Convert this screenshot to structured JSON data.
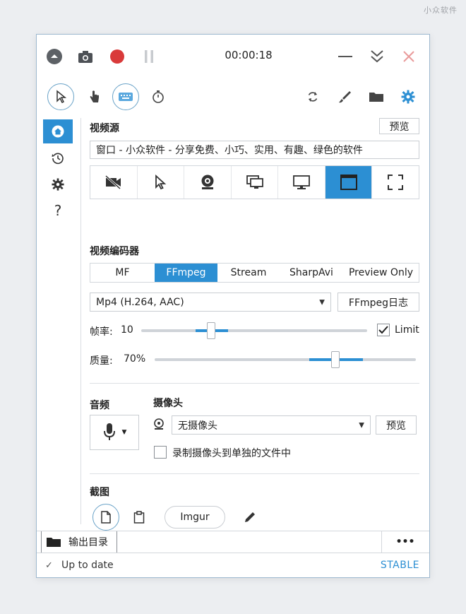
{
  "watermark": "小众软件",
  "titlebar": {
    "timer": "00:00:18"
  },
  "video_source": {
    "title": "视频源",
    "preview_label": "预览",
    "source_value": "窗口 - 小众软件 - 分享免费、小巧、实用、有趣、绿色的软件",
    "source_icons": [
      "no-video-icon",
      "cursor-icon",
      "webcam-icon",
      "multi-screen-icon",
      "monitor-icon",
      "window-icon",
      "region-icon"
    ],
    "active_source": 5
  },
  "video_encoder": {
    "title": "视频编码器",
    "tabs": [
      "MF",
      "FFmpeg",
      "Stream",
      "SharpAvi",
      "Preview Only"
    ],
    "active_tab": 1,
    "codec_value": "Mp4 (H.264, AAC)",
    "log_label": "FFmpeg日志",
    "framerate_label": "帧率:",
    "framerate_value": "10",
    "limit_label": "Limit",
    "limit_checked": true,
    "quality_label": "质量:",
    "quality_value": "70%"
  },
  "audio": {
    "title": "音频"
  },
  "webcam": {
    "title": "摄像头",
    "device_value": "无摄像头",
    "preview_label": "预览",
    "separate_file_label": "录制摄像头到单独的文件中",
    "separate_file_checked": false
  },
  "screenshot": {
    "title": "截图",
    "imgur_label": "Imgur"
  },
  "bottom": {
    "output_label": "输出目录",
    "more_label": "•••"
  },
  "status": {
    "text": "Up to date",
    "channel": "STABLE"
  },
  "colors": {
    "accent": "#2c8fd3",
    "record": "#d93a3a",
    "close": "#e89a9a"
  }
}
